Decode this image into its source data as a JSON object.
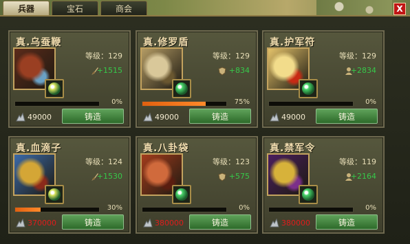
{
  "tabs": [
    "兵器",
    "宝石",
    "商会"
  ],
  "active_tab": 0,
  "close_label": "X",
  "cards": [
    {
      "title": "真.乌蚕鞭",
      "level": "等级：129",
      "stat": "+1515",
      "stat_icon": "sword-icon",
      "progress": 0,
      "progress_label": "0%",
      "cost": "49000",
      "cost_color": "white",
      "button": "铸造",
      "portrait_colors": [
        "#5b2b1a",
        "#9a3f22",
        "#6aa2c6"
      ],
      "gem_color": "#d7e35e"
    },
    {
      "title": "真.修罗盾",
      "level": "等级：129",
      "stat": "+834",
      "stat_icon": "shield-icon",
      "progress": 75,
      "progress_label": "75%",
      "cost": "49000",
      "cost_color": "white",
      "button": "铸造",
      "portrait_colors": [
        "#b39b64",
        "#d9c89a",
        "#6a5730"
      ],
      "gem_color": "#49d36a"
    },
    {
      "title": "真.护军符",
      "level": "等级：129",
      "stat": "+2834",
      "stat_icon": "person-icon",
      "progress": 0,
      "progress_label": "0%",
      "cost": "49000",
      "cost_color": "white",
      "button": "铸造",
      "portrait_colors": [
        "#e3c26a",
        "#f2dc8b",
        "#c72a14"
      ],
      "gem_color": "#49d36a"
    },
    {
      "title": "真.血滴子",
      "level": "等级：124",
      "stat": "+1530",
      "stat_icon": "sword-icon",
      "progress": 30,
      "progress_label": "30%",
      "cost": "370000",
      "cost_color": "red",
      "button": "铸造",
      "portrait_colors": [
        "#3b6aa8",
        "#d4a636",
        "#8b2a1a"
      ],
      "gem_color": "#d7e35e"
    },
    {
      "title": "真.八卦袋",
      "level": "等级：123",
      "stat": "+575",
      "stat_icon": "shield-icon",
      "progress": 0,
      "progress_label": "0%",
      "cost": "380000",
      "cost_color": "red",
      "button": "铸造",
      "portrait_colors": [
        "#a33c1c",
        "#d06a3c",
        "#5a1d10"
      ],
      "gem_color": "#49d36a"
    },
    {
      "title": "真.禁军令",
      "level": "等级：119",
      "stat": "+2164",
      "stat_icon": "person-icon",
      "progress": 0,
      "progress_label": "0%",
      "cost": "380000",
      "cost_color": "red",
      "button": "铸造",
      "portrait_colors": [
        "#4a1f5e",
        "#d7b23a",
        "#7b2f8a"
      ],
      "gem_color": "#49d36a"
    }
  ]
}
